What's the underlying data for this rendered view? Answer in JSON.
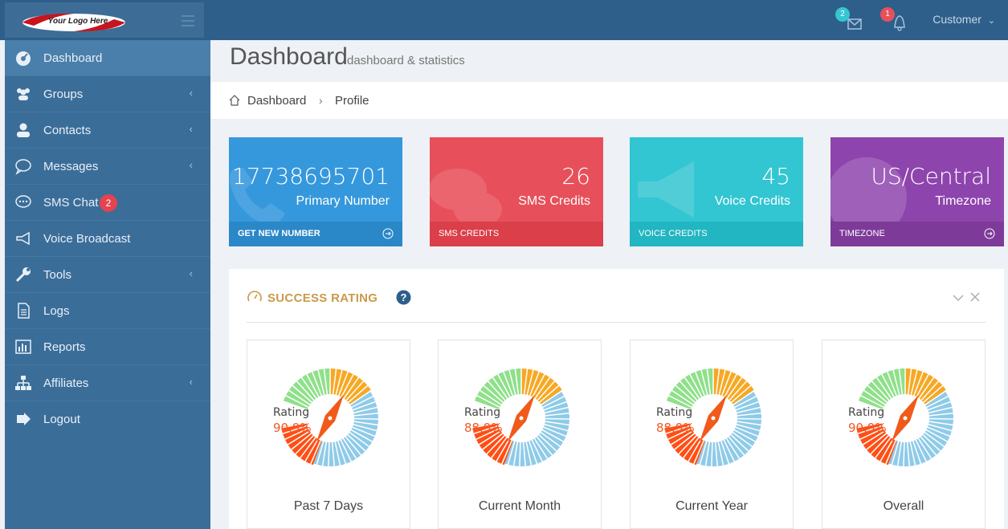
{
  "brand": {
    "logo_text": "Your Logo Here"
  },
  "topbar": {
    "messages_count": "2",
    "notifications_count": "1",
    "user_label": "Customer"
  },
  "sidebar": {
    "items": [
      {
        "label": "Dashboard",
        "icon": "dashboard-icon"
      },
      {
        "label": "Groups",
        "icon": "users-icon"
      },
      {
        "label": "Contacts",
        "icon": "user-icon"
      },
      {
        "label": "Messages",
        "icon": "speech-bubble-icon"
      },
      {
        "label": "SMS Chat",
        "icon": "chat-icon",
        "badge": "2"
      },
      {
        "label": "Voice Broadcast",
        "icon": "megaphone-icon"
      },
      {
        "label": "Tools",
        "icon": "wrench-icon"
      },
      {
        "label": "Logs",
        "icon": "document-icon"
      },
      {
        "label": "Reports",
        "icon": "bar-chart-icon"
      },
      {
        "label": "Affiliates",
        "icon": "sitemap-icon"
      },
      {
        "label": "Logout",
        "icon": "logout-icon"
      }
    ]
  },
  "page": {
    "title": "Dashboard",
    "subtitle": "dashboard & statistics"
  },
  "breadcrumb": {
    "home": "Dashboard",
    "current": "Profile"
  },
  "tiles": [
    {
      "value": "17738695701",
      "label": "Primary Number",
      "footer": "GET NEW NUMBER",
      "color": "#3598dc"
    },
    {
      "value": "26",
      "label": "SMS Credits",
      "footer": "SMS CREDITS",
      "color": "#e7505a"
    },
    {
      "value": "45",
      "label": "Voice Credits",
      "footer": "VOICE CREDITS",
      "color": "#32c5d2"
    },
    {
      "value": "US/Central",
      "label": "Timezone",
      "footer": "TIMEZONE",
      "color": "#8e44ad"
    }
  ],
  "success_rating": {
    "title": "SUCCESS RATING",
    "cards": [
      {
        "period": "Past 7 Days",
        "rating_label": "Rating",
        "rating_value": "90.9%",
        "rating_fraction": 0.909
      },
      {
        "period": "Current Month",
        "rating_label": "Rating",
        "rating_value": "88.9%",
        "rating_fraction": 0.889
      },
      {
        "period": "Current Year",
        "rating_label": "Rating",
        "rating_value": "88.9%",
        "rating_fraction": 0.889
      },
      {
        "period": "Overall",
        "rating_label": "Rating",
        "rating_value": "90.9%",
        "rating_fraction": 0.909
      }
    ]
  }
}
